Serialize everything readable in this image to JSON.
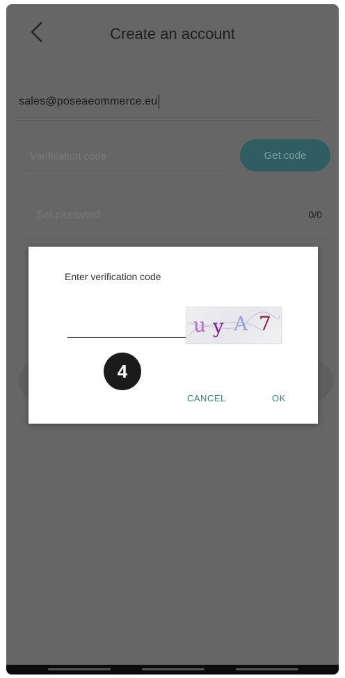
{
  "header": {
    "title": "Create an account"
  },
  "form": {
    "email_value": "sales@poseaeommerce.eu",
    "code_placeholder": "Verification code",
    "send_button": "Get code",
    "password_placeholder": "Set password",
    "password_counter": "0/0"
  },
  "dialog": {
    "title": "Enter verification code",
    "input_value": "",
    "captcha": {
      "chars": [
        "u",
        "y",
        "A",
        "7"
      ],
      "colors": [
        "#b46ac8",
        "#7a1f8e",
        "#9aa0d8",
        "#8a1d3c"
      ]
    },
    "cancel_label": "CANCEL",
    "ok_label": "OK"
  },
  "step_badge": "4",
  "colors": {
    "overlay": "#666666",
    "accent": "#2e7d72",
    "send_button_bg": "#2f5d61"
  }
}
